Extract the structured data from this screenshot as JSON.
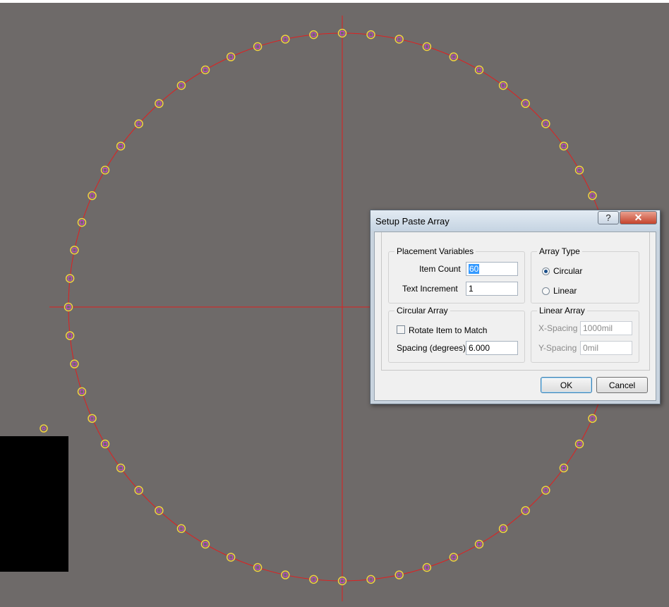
{
  "colors": {
    "canvas_background": "#6e6a69",
    "circle_line": "#e02020",
    "crosshair_line": "#e02020",
    "pad_outline": "#f0d040",
    "pad_center": "#d040d0"
  },
  "workspace": {
    "pad_count": 60,
    "array_type": "circular"
  },
  "dialog": {
    "title": "Setup Paste Array",
    "help_label": "?",
    "close_label": "✕",
    "placement": {
      "title": "Placement  Variables",
      "item_count_label": "Item Count",
      "item_count_value": "60",
      "text_increment_label": "Text Increment",
      "text_increment_value": "1"
    },
    "array_type": {
      "title": "Array Type",
      "circular_label": "Circular",
      "linear_label": "Linear",
      "selected": "Circular"
    },
    "circular_array": {
      "title": "Circular Array",
      "rotate_label": "Rotate Item to Match",
      "rotate_checked": false,
      "spacing_label": "Spacing (degrees)",
      "spacing_value": "6.000"
    },
    "linear_array": {
      "title": "Linear Array",
      "x_spacing_label": "X-Spacing",
      "x_spacing_value": "1000mil",
      "y_spacing_label": "Y-Spacing",
      "y_spacing_value": "0mil"
    },
    "ok_label": "OK",
    "cancel_label": "Cancel"
  }
}
